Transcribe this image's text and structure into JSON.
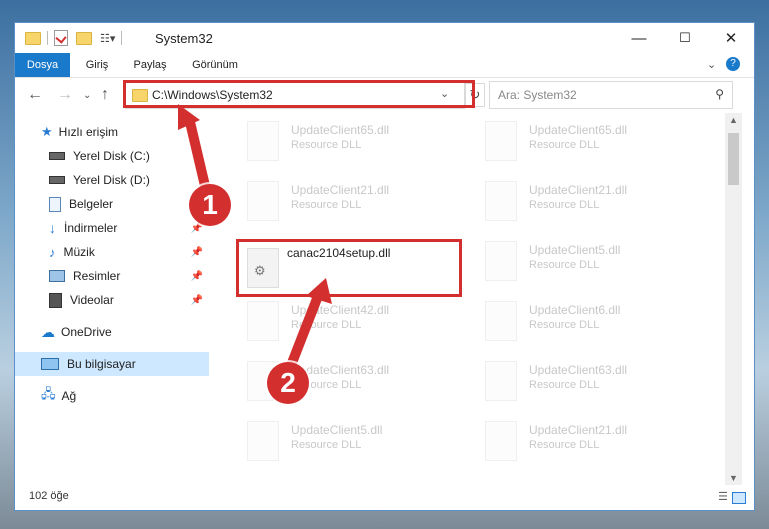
{
  "window": {
    "title": "System32",
    "controls": {
      "minimize": "—",
      "maximize": "☐",
      "close": "✕"
    }
  },
  "ribbon": {
    "tabs": [
      {
        "label": "Dosya",
        "active": true
      },
      {
        "label": "Giriş",
        "active": false
      },
      {
        "label": "Paylaş",
        "active": false
      },
      {
        "label": "Görünüm",
        "active": false
      }
    ]
  },
  "address": {
    "path": "C:\\Windows\\System32",
    "search_placeholder": "Ara: System32"
  },
  "sidebar": {
    "items": [
      {
        "label": "Hızlı erişim",
        "icon": "star-icon",
        "pinned": false,
        "selected": false
      },
      {
        "label": "Yerel Disk (C:)",
        "icon": "drive-icon",
        "pinned": false,
        "selected": false
      },
      {
        "label": "Yerel Disk (D:)",
        "icon": "drive-icon",
        "pinned": false,
        "selected": false
      },
      {
        "label": "Belgeler",
        "icon": "documents-icon",
        "pinned": true,
        "selected": false
      },
      {
        "label": "İndirmeler",
        "icon": "download-icon",
        "pinned": true,
        "selected": false
      },
      {
        "label": "Müzik",
        "icon": "music-icon",
        "pinned": true,
        "selected": false
      },
      {
        "label": "Resimler",
        "icon": "pictures-icon",
        "pinned": true,
        "selected": false
      },
      {
        "label": "Videolar",
        "icon": "videos-icon",
        "pinned": true,
        "selected": false
      },
      {
        "label": "OneDrive",
        "icon": "cloud-icon",
        "pinned": false,
        "selected": false
      },
      {
        "label": "Bu bilgisayar",
        "icon": "computer-icon",
        "pinned": false,
        "selected": true
      },
      {
        "label": "Ağ",
        "icon": "network-icon",
        "pinned": false,
        "selected": false
      }
    ]
  },
  "files": [
    {
      "name": "UpdateClient65.dll",
      "type": "Resource DLL",
      "faded": true,
      "highlighted": false
    },
    {
      "name": "UpdateClient65.dll",
      "type": "Resource DLL",
      "faded": true,
      "highlighted": false
    },
    {
      "name": "UpdateClient21.dll",
      "type": "Resource DLL",
      "faded": true,
      "highlighted": false
    },
    {
      "name": "UpdateClient21.dll",
      "type": "Resource DLL",
      "faded": true,
      "highlighted": false
    },
    {
      "name": "canac2104setup.dll",
      "type": "",
      "faded": false,
      "highlighted": true
    },
    {
      "name": "UpdateClient5.dll",
      "type": "Resource DLL",
      "faded": true,
      "highlighted": false
    },
    {
      "name": "UpdateClient42.dll",
      "type": "Resource DLL",
      "faded": true,
      "highlighted": false
    },
    {
      "name": "UpdateClient6.dll",
      "type": "Resource DLL",
      "faded": true,
      "highlighted": false
    },
    {
      "name": "UpdateClient63.dll",
      "type": "Resource DLL",
      "faded": true,
      "highlighted": false
    },
    {
      "name": "UpdateClient63.dll",
      "type": "Resource DLL",
      "faded": true,
      "highlighted": false
    },
    {
      "name": "UpdateClient5.dll",
      "type": "Resource DLL",
      "faded": true,
      "highlighted": false
    },
    {
      "name": "UpdateClient21.dll",
      "type": "Resource DLL",
      "faded": true,
      "highlighted": false
    }
  ],
  "status": {
    "item_count": "102 öğe"
  },
  "annotations": {
    "step1": "1",
    "step2": "2",
    "accent": "#d32f2f"
  }
}
